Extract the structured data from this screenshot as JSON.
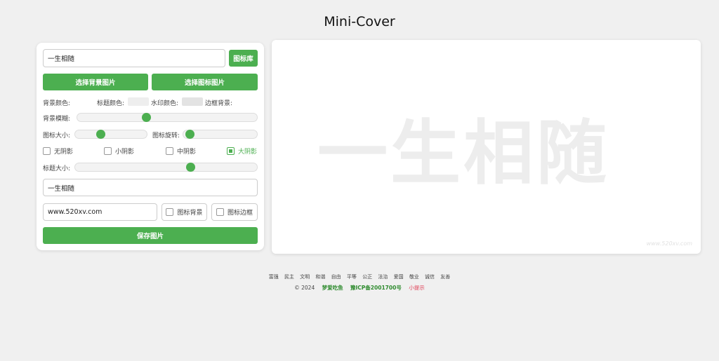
{
  "app": {
    "title": "Mini-Cover"
  },
  "controls": {
    "icon_search_value": "一生相随",
    "icon_lib_button": "图标库",
    "choose_bg_button": "选择背景图片",
    "choose_icon_button": "选择图标图片",
    "colors": {
      "bg_color_label": "背景颜色:",
      "title_color_label": "标题颜色:",
      "watermark_color_label": "水印颜色:",
      "border_bg_label": "边框背景:",
      "title_swatch": "#eeeeee",
      "watermark_swatch": "#e3e3e3"
    },
    "bg_blur_label": "背景模糊:",
    "bg_blur_value": 0.38,
    "icon_size_label": "图标大小:",
    "icon_size_value": 0.37,
    "icon_rotate_label": "图标旋转:",
    "icon_rotate_value": 0.05,
    "shadows": [
      {
        "label": "无阴影",
        "checked": false
      },
      {
        "label": "小阴影",
        "checked": false
      },
      {
        "label": "中阴影",
        "checked": false
      },
      {
        "label": "大阴影",
        "checked": true
      }
    ],
    "title_size_label": "标题大小:",
    "title_size_value": 0.63,
    "title_text_value": "一生相随",
    "watermark_url_value": "www.520xv.com",
    "icon_bg_label": "图标背景",
    "icon_border_label": "图标边框",
    "save_button": "保存图片"
  },
  "preview": {
    "watermark_title": "一生相随",
    "watermark_url": "www.520xv.com"
  },
  "footer": {
    "values": [
      "富强",
      "民主",
      "文明",
      "和谐",
      "自由",
      "平等",
      "公正",
      "法治",
      "爱国",
      "敬业",
      "诚信",
      "友善"
    ],
    "copyright": "© 2024",
    "site_name": "梦爱吃鱼",
    "icp": "豫ICP备2001700号",
    "tip": "小提示"
  },
  "accent_color": "#4caf50"
}
